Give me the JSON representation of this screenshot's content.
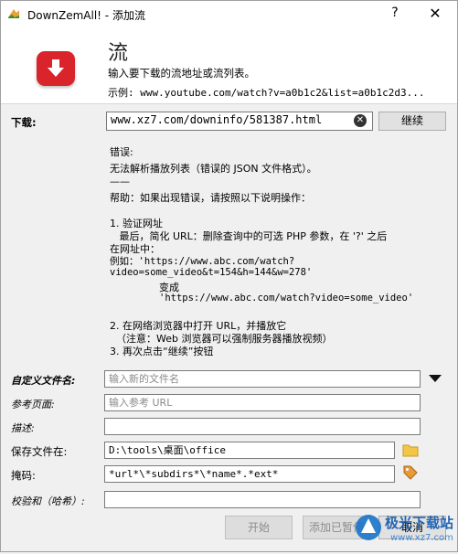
{
  "window": {
    "title": "DownZemAll! - 添加流",
    "help_glyph": "?",
    "close_glyph": "✕"
  },
  "header": {
    "title": "流",
    "subtitle": "输入要下载的流地址或流列表。",
    "example": "示例:  www.youtube.com/watch?v=a0b1c2&list=a0b1c2d3..."
  },
  "download": {
    "label": "下载:",
    "value": "www.xz7.com/downinfo/581387.html",
    "continue_label": "继续"
  },
  "error": {
    "heading": "错误:",
    "message": "无法解析播放列表（错误的 JSON 文件格式）。",
    "rule": "——",
    "help": "帮助：如果出现错误，请按照以下说明操作：",
    "step1_title": "1. 验证网址",
    "step1_line1": "   最后，简化 URL：删除查询中的可选 PHP 参数，在 '?' 之后",
    "step1_line2": "在网址中：",
    "step1_line3": "例如：'https://www.abc.com/watch?",
    "step1_line4": "video=some_video&t=154&h=144&w=278'",
    "step1_line5": "变成",
    "step1_line6": "'https://www.abc.com/watch?video=some_video'",
    "step2_title": "2. 在网络浏览器中打开 URL，并播放它",
    "step2_note": "  （注意：Web 浏览器可以强制服务器播放视频）",
    "step3": "3. 再次点击“继续”按钮"
  },
  "form": {
    "filename_label": "自定义文件名:",
    "filename_placeholder": "输入新的文件名",
    "referer_label": "参考页面:",
    "referer_placeholder": "输入参考 URL",
    "desc_label": "描述:",
    "desc_value": "",
    "saveto_label": "保存文件在:",
    "saveto_value": "D:\\tools\\桌面\\office",
    "mask_label": "掩码:",
    "mask_value": "*url*\\*subdirs*\\*name*.*ext*",
    "checksum_label": "校验和（哈希）:",
    "checksum_value": ""
  },
  "buttons": {
    "start": "开始",
    "add_paused": "添加已暂停",
    "cancel": "取消"
  },
  "watermark": {
    "text": "极光下载站",
    "url": "www.xz7.com"
  },
  "colors": {
    "logo_red": "#d9242b",
    "accent_blue": "#1a73c9",
    "folder_yellow": "#f3c64a"
  }
}
